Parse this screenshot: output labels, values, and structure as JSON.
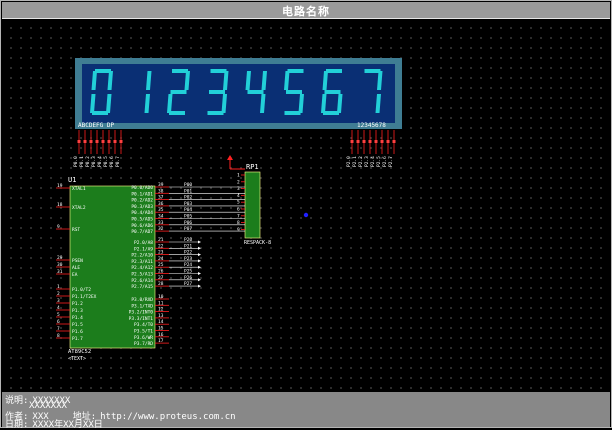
{
  "window": {
    "title": "电路名称"
  },
  "display": {
    "digits": [
      "0",
      "1",
      "2",
      "3",
      "4",
      "5",
      "6",
      "7"
    ],
    "left_label": "ABCDEFG  DP",
    "right_label": "12345678",
    "left_pins": [
      "P0.0",
      "P0.1",
      "P0.2",
      "P0.3",
      "P0.4",
      "P0.5",
      "P0.6",
      "P0.7"
    ],
    "right_pins": [
      "P2.0",
      "P2.1",
      "P2.2",
      "P2.3",
      "P2.4",
      "P2.5",
      "P2.6",
      "P2.7"
    ],
    "color_bg": "#0a2f74",
    "color_digit": "#22d0d8",
    "color_frame": "#3f7d93"
  },
  "chip": {
    "ref": "U1",
    "part": "AT89C52",
    "footer_text": "<TEXT>",
    "left_pins": [
      {
        "num": "19",
        "name": "XTAL1"
      },
      {
        "num": "18",
        "name": "XTAL2"
      },
      {
        "num": "9",
        "name": "RST"
      },
      {
        "num": "29",
        "name": "PSEN"
      },
      {
        "num": "30",
        "name": "ALE"
      },
      {
        "num": "31",
        "name": "EA"
      },
      {
        "num": "1",
        "name": "P1.0/T2"
      },
      {
        "num": "2",
        "name": "P1.1/T2EX"
      },
      {
        "num": "3",
        "name": "P1.2"
      },
      {
        "num": "4",
        "name": "P1.3"
      },
      {
        "num": "5",
        "name": "P1.4"
      },
      {
        "num": "6",
        "name": "P1.5"
      },
      {
        "num": "7",
        "name": "P1.6"
      },
      {
        "num": "8",
        "name": "P1.7"
      }
    ],
    "right_pins_p0": [
      {
        "num": "39",
        "name": "P0.0/AD0",
        "net": "P00"
      },
      {
        "num": "38",
        "name": "P0.1/AD1",
        "net": "P01"
      },
      {
        "num": "37",
        "name": "P0.2/AD2",
        "net": "P02"
      },
      {
        "num": "36",
        "name": "P0.3/AD3",
        "net": "P03"
      },
      {
        "num": "35",
        "name": "P0.4/AD4",
        "net": "P04"
      },
      {
        "num": "34",
        "name": "P0.5/AD5",
        "net": "P05"
      },
      {
        "num": "33",
        "name": "P0.6/AD6",
        "net": "P06"
      },
      {
        "num": "32",
        "name": "P0.7/AD7",
        "net": "P07"
      }
    ],
    "right_pins_p2": [
      {
        "num": "21",
        "name": "P2.0/A8",
        "net": "P20"
      },
      {
        "num": "22",
        "name": "P2.1/A9",
        "net": "P21"
      },
      {
        "num": "23",
        "name": "P2.2/A10",
        "net": "P22"
      },
      {
        "num": "24",
        "name": "P2.3/A11",
        "net": "P23"
      },
      {
        "num": "25",
        "name": "P2.4/A12",
        "net": "P24"
      },
      {
        "num": "26",
        "name": "P2.5/A13",
        "net": "P25"
      },
      {
        "num": "27",
        "name": "P2.6/A14",
        "net": "P26"
      },
      {
        "num": "28",
        "name": "P2.7/A15",
        "net": "P27"
      }
    ],
    "right_pins_p3": [
      {
        "num": "10",
        "name": "P3.0/RXD"
      },
      {
        "num": "11",
        "name": "P3.1/TXD"
      },
      {
        "num": "12",
        "name": "P3.2/INT0"
      },
      {
        "num": "13",
        "name": "P3.3/INT1"
      },
      {
        "num": "14",
        "name": "P3.4/T0"
      },
      {
        "num": "15",
        "name": "P3.5/T1"
      },
      {
        "num": "16",
        "name": "P3.6/WR"
      },
      {
        "num": "17",
        "name": "P3.7/RD"
      }
    ],
    "color_body": "#1c7d1c",
    "color_text": "#ffffff",
    "color_pin": "#ff2020"
  },
  "rpack": {
    "ref": "RP1",
    "part": "RESPACK-8",
    "pin_numbers": [
      "1",
      "2",
      "3",
      "4",
      "5",
      "6",
      "7",
      "8",
      "9"
    ],
    "color_body": "#1c7d1c"
  },
  "footer": {
    "desc_label": "说明:",
    "desc_line1": "XXXXXXX",
    "desc_line2": "XXXXXXX",
    "author_label": "作者:",
    "author_value": "XXX",
    "url_label": "地址:",
    "url_value": "http://www.proteus.com.cn",
    "date_label": "日期:",
    "date_value": "XXXX年XX月XX日"
  }
}
